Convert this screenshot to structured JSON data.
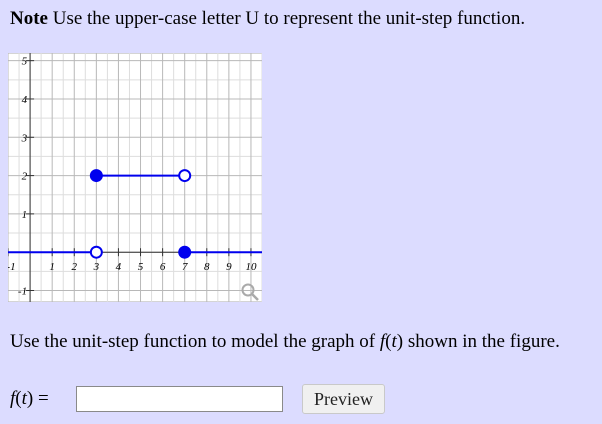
{
  "note": {
    "label": "Note",
    "text": "Use the upper-case letter U to represent the unit-step function."
  },
  "graph": {
    "x_tick_labels": [
      "-1",
      "1",
      "2",
      "3",
      "4",
      "5",
      "6",
      "7",
      "8",
      "9",
      "10"
    ],
    "y_tick_labels": [
      "5",
      "4",
      "3",
      "2",
      "1",
      "-1"
    ],
    "zoom_icon": "magnifier-icon"
  },
  "chart_data": {
    "type": "line",
    "xlim": [
      -1,
      10.5
    ],
    "ylim": [
      -1.3,
      5.2
    ],
    "grid": true,
    "x_ticks": [
      -1,
      1,
      2,
      3,
      4,
      5,
      6,
      7,
      8,
      9,
      10
    ],
    "y_ticks": [
      -1,
      1,
      2,
      3,
      4,
      5
    ],
    "segments": [
      {
        "x": [
          -1,
          3
        ],
        "y": [
          0,
          0
        ]
      },
      {
        "x": [
          3,
          7
        ],
        "y": [
          2,
          2
        ]
      },
      {
        "x": [
          7,
          10.5
        ],
        "y": [
          0,
          0
        ]
      }
    ],
    "points": [
      {
        "x": 3,
        "y": 2,
        "filled": true
      },
      {
        "x": 7,
        "y": 2,
        "filled": false
      },
      {
        "x": 3,
        "y": 0,
        "filled": false
      },
      {
        "x": 7,
        "y": 0,
        "filled": true
      }
    ],
    "color": "#0000ee"
  },
  "instruction": {
    "before": "Use the unit-step function to model the graph of ",
    "func": "f",
    "paren_open": "(",
    "var": "t",
    "paren_close": ")",
    "after": " shown in the figure."
  },
  "answer": {
    "label_func": "f",
    "label_open": "(",
    "label_var": "t",
    "label_close": ")",
    "equals": " =",
    "input_value": ""
  },
  "preview_button": {
    "label": "Preview"
  }
}
